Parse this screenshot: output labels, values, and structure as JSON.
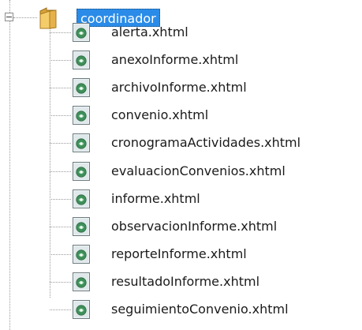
{
  "tree": {
    "root": {
      "label": "coordinador",
      "icon": "folder-icon",
      "expanded": true,
      "selected": true
    },
    "children": [
      {
        "label": "alerta.xhtml",
        "icon": "xhtml-file-icon"
      },
      {
        "label": "anexoInforme.xhtml",
        "icon": "xhtml-file-icon"
      },
      {
        "label": "archivoInforme.xhtml",
        "icon": "xhtml-file-icon"
      },
      {
        "label": "convenio.xhtml",
        "icon": "xhtml-file-icon"
      },
      {
        "label": "cronogramaActividades.xhtml",
        "icon": "xhtml-file-icon"
      },
      {
        "label": "evaluacionConvenios.xhtml",
        "icon": "xhtml-file-icon"
      },
      {
        "label": "informe.xhtml",
        "icon": "xhtml-file-icon"
      },
      {
        "label": "observacionInforme.xhtml",
        "icon": "xhtml-file-icon"
      },
      {
        "label": "reporteInforme.xhtml",
        "icon": "xhtml-file-icon"
      },
      {
        "label": "resultadoInforme.xhtml",
        "icon": "xhtml-file-icon"
      },
      {
        "label": "seguimientoConvenio.xhtml",
        "icon": "xhtml-file-icon"
      }
    ]
  },
  "colors": {
    "selection": "#2a8ce8",
    "selection_text": "#ffffff",
    "folder": "#e8b84a",
    "file_icon_accent": "#3f8f5a"
  }
}
